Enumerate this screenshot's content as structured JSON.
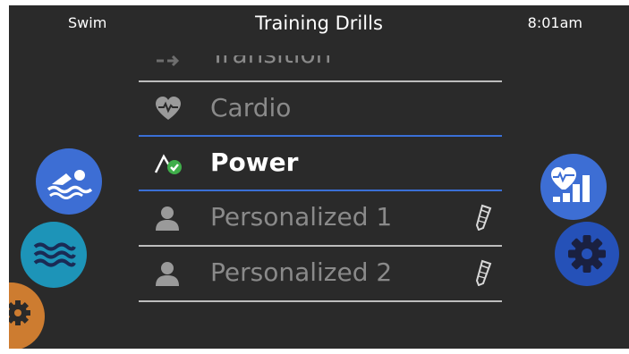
{
  "header": {
    "mode": "Swim",
    "title": "Training Drills",
    "clock": "8:01am"
  },
  "drills": [
    {
      "label": "Transition",
      "icon": "transition-icon",
      "state": "partially-scrolled"
    },
    {
      "label": "Cardio",
      "icon": "heart-pulse-icon",
      "state": "normal"
    },
    {
      "label": "Power",
      "icon": "power-check-icon",
      "state": "selected"
    },
    {
      "label": "Personalized 1",
      "icon": "person-icon",
      "state": "normal",
      "editable": true
    },
    {
      "label": "Personalized 2",
      "icon": "person-icon",
      "state": "normal",
      "editable": true
    }
  ],
  "side_buttons": {
    "left": [
      "swimmer-icon",
      "water-waves-icon",
      "gear-icon"
    ],
    "right": [
      "heart-stats-icon",
      "gear-icon"
    ]
  },
  "colors": {
    "background": "#2a2a2a",
    "accent_blue": "#3d6ed4",
    "selection_line": "#3a6fd6",
    "water_teal": "#1d94b8",
    "amber": "#cd7c30",
    "check_green": "#3fae4a"
  }
}
